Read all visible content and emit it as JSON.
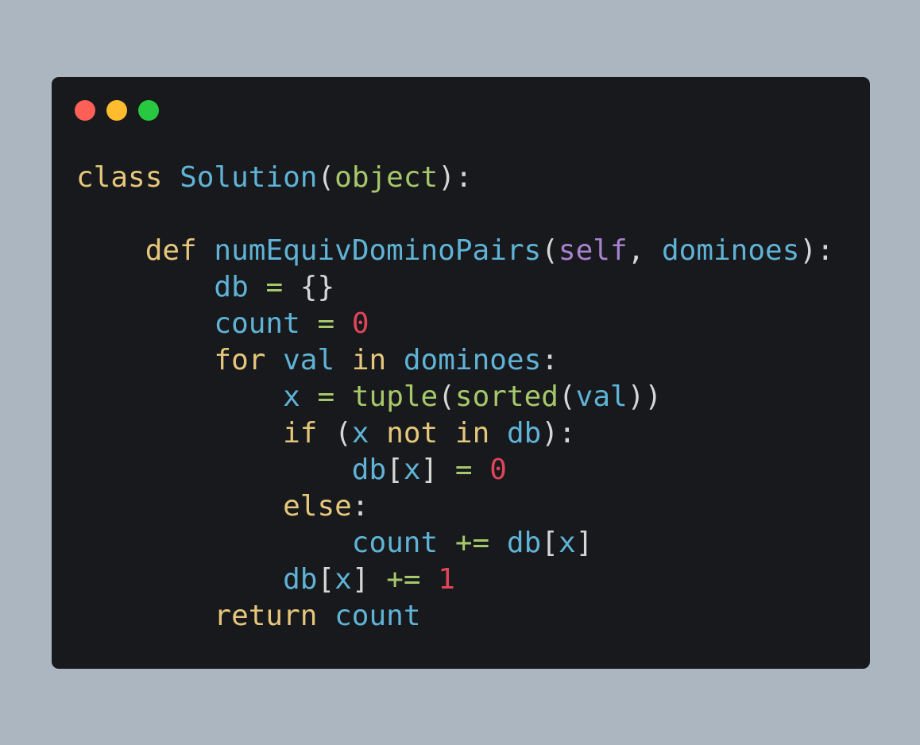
{
  "window": {
    "controls": [
      {
        "name": "close",
        "color": "#fe5f57"
      },
      {
        "name": "minimize",
        "color": "#febc2e"
      },
      {
        "name": "maximize",
        "color": "#28c840"
      }
    ],
    "background": "#17191c"
  },
  "theme": {
    "keyword": "#e5c67b",
    "ident": "#5fb3d6",
    "func": "#a6c86a",
    "self": "#a982cf",
    "number": "#e0455a",
    "operator": "#a6c86a",
    "punct": "#d6d6d6"
  },
  "code": {
    "lines": [
      [
        {
          "t": "class",
          "c": "keyword"
        },
        {
          "t": " ",
          "c": "punct"
        },
        {
          "t": "Solution",
          "c": "ident"
        },
        {
          "t": "(",
          "c": "punct"
        },
        {
          "t": "object",
          "c": "func"
        },
        {
          "t": "):",
          "c": "punct"
        }
      ],
      [],
      [
        {
          "t": "    ",
          "c": "punct"
        },
        {
          "t": "def",
          "c": "keyword"
        },
        {
          "t": " ",
          "c": "punct"
        },
        {
          "t": "numEquivDominoPairs",
          "c": "ident"
        },
        {
          "t": "(",
          "c": "punct"
        },
        {
          "t": "self",
          "c": "self"
        },
        {
          "t": ", ",
          "c": "punct"
        },
        {
          "t": "dominoes",
          "c": "ident"
        },
        {
          "t": "):",
          "c": "punct"
        }
      ],
      [
        {
          "t": "        ",
          "c": "punct"
        },
        {
          "t": "db",
          "c": "ident"
        },
        {
          "t": " ",
          "c": "punct"
        },
        {
          "t": "=",
          "c": "operator"
        },
        {
          "t": " {}",
          "c": "punct"
        }
      ],
      [
        {
          "t": "        ",
          "c": "punct"
        },
        {
          "t": "count",
          "c": "ident"
        },
        {
          "t": " ",
          "c": "punct"
        },
        {
          "t": "=",
          "c": "operator"
        },
        {
          "t": " ",
          "c": "punct"
        },
        {
          "t": "0",
          "c": "number"
        }
      ],
      [
        {
          "t": "        ",
          "c": "punct"
        },
        {
          "t": "for",
          "c": "keyword"
        },
        {
          "t": " ",
          "c": "punct"
        },
        {
          "t": "val",
          "c": "ident"
        },
        {
          "t": " ",
          "c": "punct"
        },
        {
          "t": "in",
          "c": "keyword"
        },
        {
          "t": " ",
          "c": "punct"
        },
        {
          "t": "dominoes",
          "c": "ident"
        },
        {
          "t": ":",
          "c": "punct"
        }
      ],
      [
        {
          "t": "            ",
          "c": "punct"
        },
        {
          "t": "x",
          "c": "ident"
        },
        {
          "t": " ",
          "c": "punct"
        },
        {
          "t": "=",
          "c": "operator"
        },
        {
          "t": " ",
          "c": "punct"
        },
        {
          "t": "tuple",
          "c": "func"
        },
        {
          "t": "(",
          "c": "punct"
        },
        {
          "t": "sorted",
          "c": "func"
        },
        {
          "t": "(",
          "c": "punct"
        },
        {
          "t": "val",
          "c": "ident"
        },
        {
          "t": "))",
          "c": "punct"
        }
      ],
      [
        {
          "t": "            ",
          "c": "punct"
        },
        {
          "t": "if",
          "c": "keyword"
        },
        {
          "t": " (",
          "c": "punct"
        },
        {
          "t": "x",
          "c": "ident"
        },
        {
          "t": " ",
          "c": "punct"
        },
        {
          "t": "not",
          "c": "keyword"
        },
        {
          "t": " ",
          "c": "punct"
        },
        {
          "t": "in",
          "c": "keyword"
        },
        {
          "t": " ",
          "c": "punct"
        },
        {
          "t": "db",
          "c": "ident"
        },
        {
          "t": "):",
          "c": "punct"
        }
      ],
      [
        {
          "t": "                ",
          "c": "punct"
        },
        {
          "t": "db",
          "c": "ident"
        },
        {
          "t": "[",
          "c": "punct"
        },
        {
          "t": "x",
          "c": "ident"
        },
        {
          "t": "] ",
          "c": "punct"
        },
        {
          "t": "=",
          "c": "operator"
        },
        {
          "t": " ",
          "c": "punct"
        },
        {
          "t": "0",
          "c": "number"
        }
      ],
      [
        {
          "t": "            ",
          "c": "punct"
        },
        {
          "t": "else",
          "c": "keyword"
        },
        {
          "t": ":",
          "c": "punct"
        }
      ],
      [
        {
          "t": "                ",
          "c": "punct"
        },
        {
          "t": "count",
          "c": "ident"
        },
        {
          "t": " ",
          "c": "punct"
        },
        {
          "t": "+=",
          "c": "operator"
        },
        {
          "t": " ",
          "c": "punct"
        },
        {
          "t": "db",
          "c": "ident"
        },
        {
          "t": "[",
          "c": "punct"
        },
        {
          "t": "x",
          "c": "ident"
        },
        {
          "t": "]",
          "c": "punct"
        }
      ],
      [
        {
          "t": "            ",
          "c": "punct"
        },
        {
          "t": "db",
          "c": "ident"
        },
        {
          "t": "[",
          "c": "punct"
        },
        {
          "t": "x",
          "c": "ident"
        },
        {
          "t": "] ",
          "c": "punct"
        },
        {
          "t": "+=",
          "c": "operator"
        },
        {
          "t": " ",
          "c": "punct"
        },
        {
          "t": "1",
          "c": "number"
        }
      ],
      [
        {
          "t": "        ",
          "c": "punct"
        },
        {
          "t": "return",
          "c": "keyword"
        },
        {
          "t": " ",
          "c": "punct"
        },
        {
          "t": "count",
          "c": "ident"
        }
      ]
    ]
  }
}
